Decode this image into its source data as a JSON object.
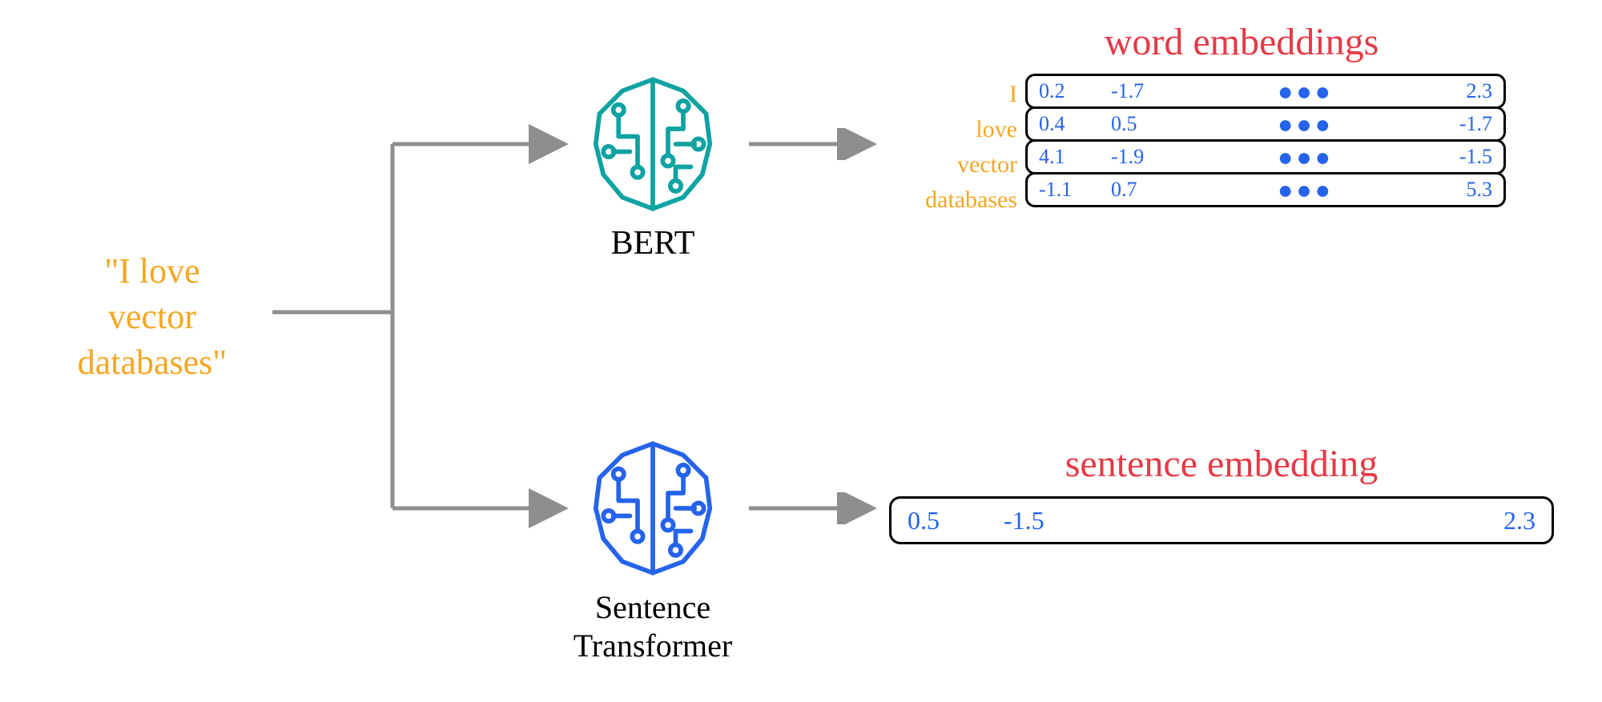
{
  "input_text_line1": "\"I love",
  "input_text_line2": "vector",
  "input_text_line3": "databases\"",
  "models": {
    "bert": {
      "label": "BERT"
    },
    "sentence_transformer": {
      "label_line1": "Sentence",
      "label_line2": "Transformer"
    }
  },
  "word_embeddings": {
    "title": "word embeddings",
    "labels": [
      "I",
      "love",
      "vector",
      "databases"
    ],
    "rows": [
      {
        "v1": "0.2",
        "v2": "-1.7",
        "dots": "●●●",
        "vlast": "2.3"
      },
      {
        "v1": "0.4",
        "v2": "0.5",
        "dots": "●●●",
        "vlast": "-1.7"
      },
      {
        "v1": "4.1",
        "v2": "-1.9",
        "dots": "●●●",
        "vlast": "-1.5"
      },
      {
        "v1": "-1.1",
        "v2": "0.7",
        "dots": "●●●",
        "vlast": "5.3"
      }
    ]
  },
  "sentence_embedding": {
    "title": "sentence embedding",
    "values": {
      "v1": "0.5",
      "v2": "-1.5",
      "vlast": "2.3"
    }
  },
  "colors": {
    "orange": "#F5A623",
    "red": "#E63946",
    "blue": "#2563EB",
    "teal": "#0FA3A3",
    "arrow": "#8E8E8E"
  }
}
